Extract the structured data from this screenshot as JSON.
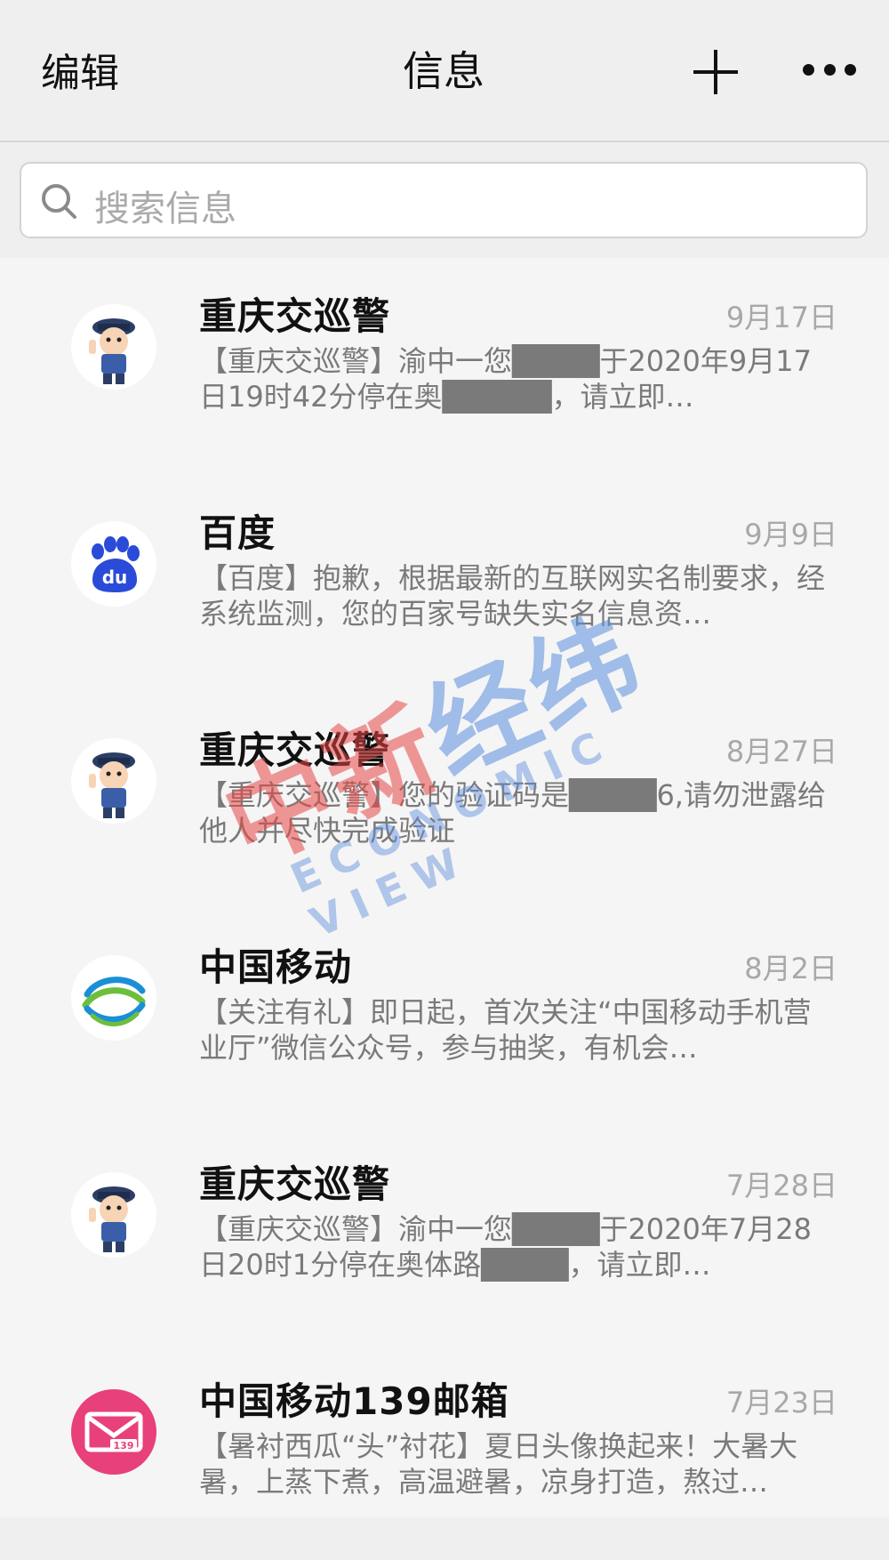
{
  "nav": {
    "edit_label": "编辑",
    "title": "信息"
  },
  "search": {
    "placeholder": "搜索信息"
  },
  "messages": [
    {
      "sender": "重庆交巡警",
      "date": "9月17日",
      "preview": "【重庆交巡警】渝中一您████于2020年9月17日19时42分停在奥█████，请立即…",
      "avatar": "police-avatar"
    },
    {
      "sender": "百度",
      "date": "9月9日",
      "preview": "【百度】抱歉，根据最新的互联网实名制要求，经系统监测，您的百家号缺失实名信息资…",
      "avatar": "baidu-logo"
    },
    {
      "sender": "重庆交巡警",
      "date": "8月27日",
      "preview": "【重庆交巡警】您的验证码是████6,请勿泄露给他人并尽快完成验证",
      "avatar": "police-avatar"
    },
    {
      "sender": "中国移动",
      "date": "8月2日",
      "preview": "【关注有礼】即日起，首次关注“中国移动手机营业厅”微信公众号，参与抽奖，有机会…",
      "avatar": "china-mobile-logo"
    },
    {
      "sender": "重庆交巡警",
      "date": "7月28日",
      "preview": "【重庆交巡警】渝中一您████于2020年7月28日20时1分停在奥体路████，请立即…",
      "avatar": "police-avatar"
    },
    {
      "sender": "中国移动139邮箱",
      "date": "7月23日",
      "preview": "【暑衬西瓜“头”衬花】夏日头像换起来！大暑大暑，上蒸下煮，高温避暑，凉身打造，熬过…",
      "avatar": "mail139-logo"
    }
  ],
  "watermark": {
    "cn_red": "中新",
    "cn_blue": "经纬",
    "en": "ECONOMIC VIEW"
  },
  "colors": {
    "baidu_blue": "#2a4bd8",
    "mail139_pink": "#e8407a",
    "mobile_blue": "#1a8fd6",
    "mobile_green": "#6cbf3c"
  }
}
